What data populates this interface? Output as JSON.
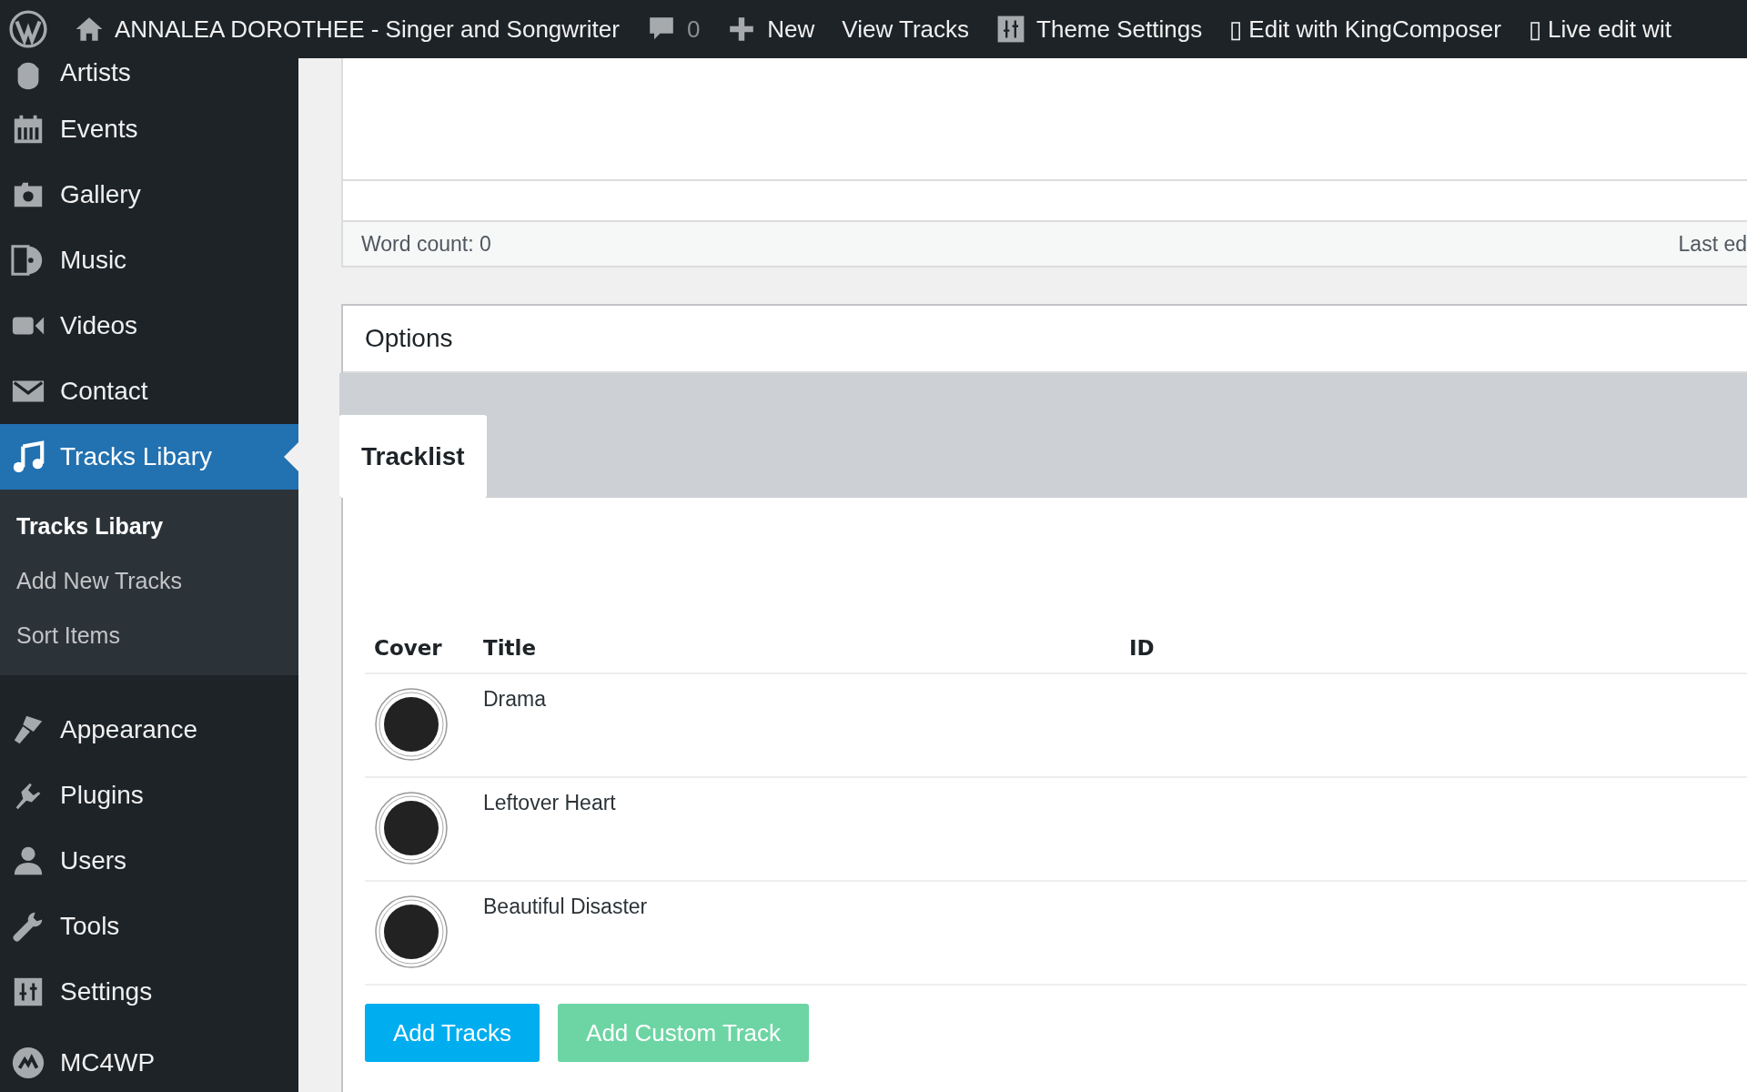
{
  "admin_bar": {
    "items": [
      {
        "kind": "site",
        "label": "ANNALEA DOROTHEE - Singer and Songwriter"
      },
      {
        "kind": "comments",
        "label": "0"
      },
      {
        "kind": "new",
        "label": "New"
      },
      {
        "kind": "plain",
        "label": "View Tracks"
      },
      {
        "kind": "settings",
        "label": "Theme Settings"
      },
      {
        "kind": "glyph",
        "glyph": "▯",
        "label": "Edit with KingComposer"
      },
      {
        "kind": "glyph",
        "glyph": "▯",
        "label": "Live edit wit"
      }
    ]
  },
  "sidebar": {
    "items": [
      {
        "kind": "artists",
        "label": "Artists",
        "selected": false
      },
      {
        "kind": "events",
        "label": "Events",
        "selected": false
      },
      {
        "kind": "gallery",
        "label": "Gallery",
        "selected": false
      },
      {
        "kind": "music",
        "label": "Music",
        "selected": false
      },
      {
        "kind": "videos",
        "label": "Videos",
        "selected": false
      },
      {
        "kind": "contact",
        "label": "Contact",
        "selected": false
      },
      {
        "kind": "tracks",
        "label": "Tracks Libary",
        "selected": true,
        "children": [
          {
            "label": "Tracks Libary",
            "selected": true
          },
          {
            "label": "Add New Tracks",
            "selected": false
          },
          {
            "label": "Sort Items",
            "selected": false
          }
        ]
      },
      {
        "kind": "appearance",
        "label": "Appearance",
        "selected": false
      },
      {
        "kind": "plugins",
        "label": "Plugins",
        "selected": false
      },
      {
        "kind": "users",
        "label": "Users",
        "selected": false
      },
      {
        "kind": "tools",
        "label": "Tools",
        "selected": false
      },
      {
        "kind": "settings",
        "label": "Settings",
        "selected": false
      },
      {
        "kind": "mc4wp",
        "label": "MC4WP",
        "selected": false
      }
    ]
  },
  "editor": {
    "word_count": "Word count: 0",
    "last_edited": "Last ed"
  },
  "options": {
    "title": "Options",
    "tabs": [
      {
        "label": "Tracklist",
        "selected": true
      }
    ],
    "table": {
      "columns": [
        "Cover",
        "Title",
        "ID"
      ],
      "rows": [
        {
          "title": "Drama"
        },
        {
          "title": "Leftover Heart"
        },
        {
          "title": "Beautiful Disaster"
        }
      ]
    },
    "buttons": [
      {
        "kind": "primary",
        "label": "Add Tracks"
      },
      {
        "kind": "secondary",
        "label": "Add Custom Track"
      }
    ]
  }
}
